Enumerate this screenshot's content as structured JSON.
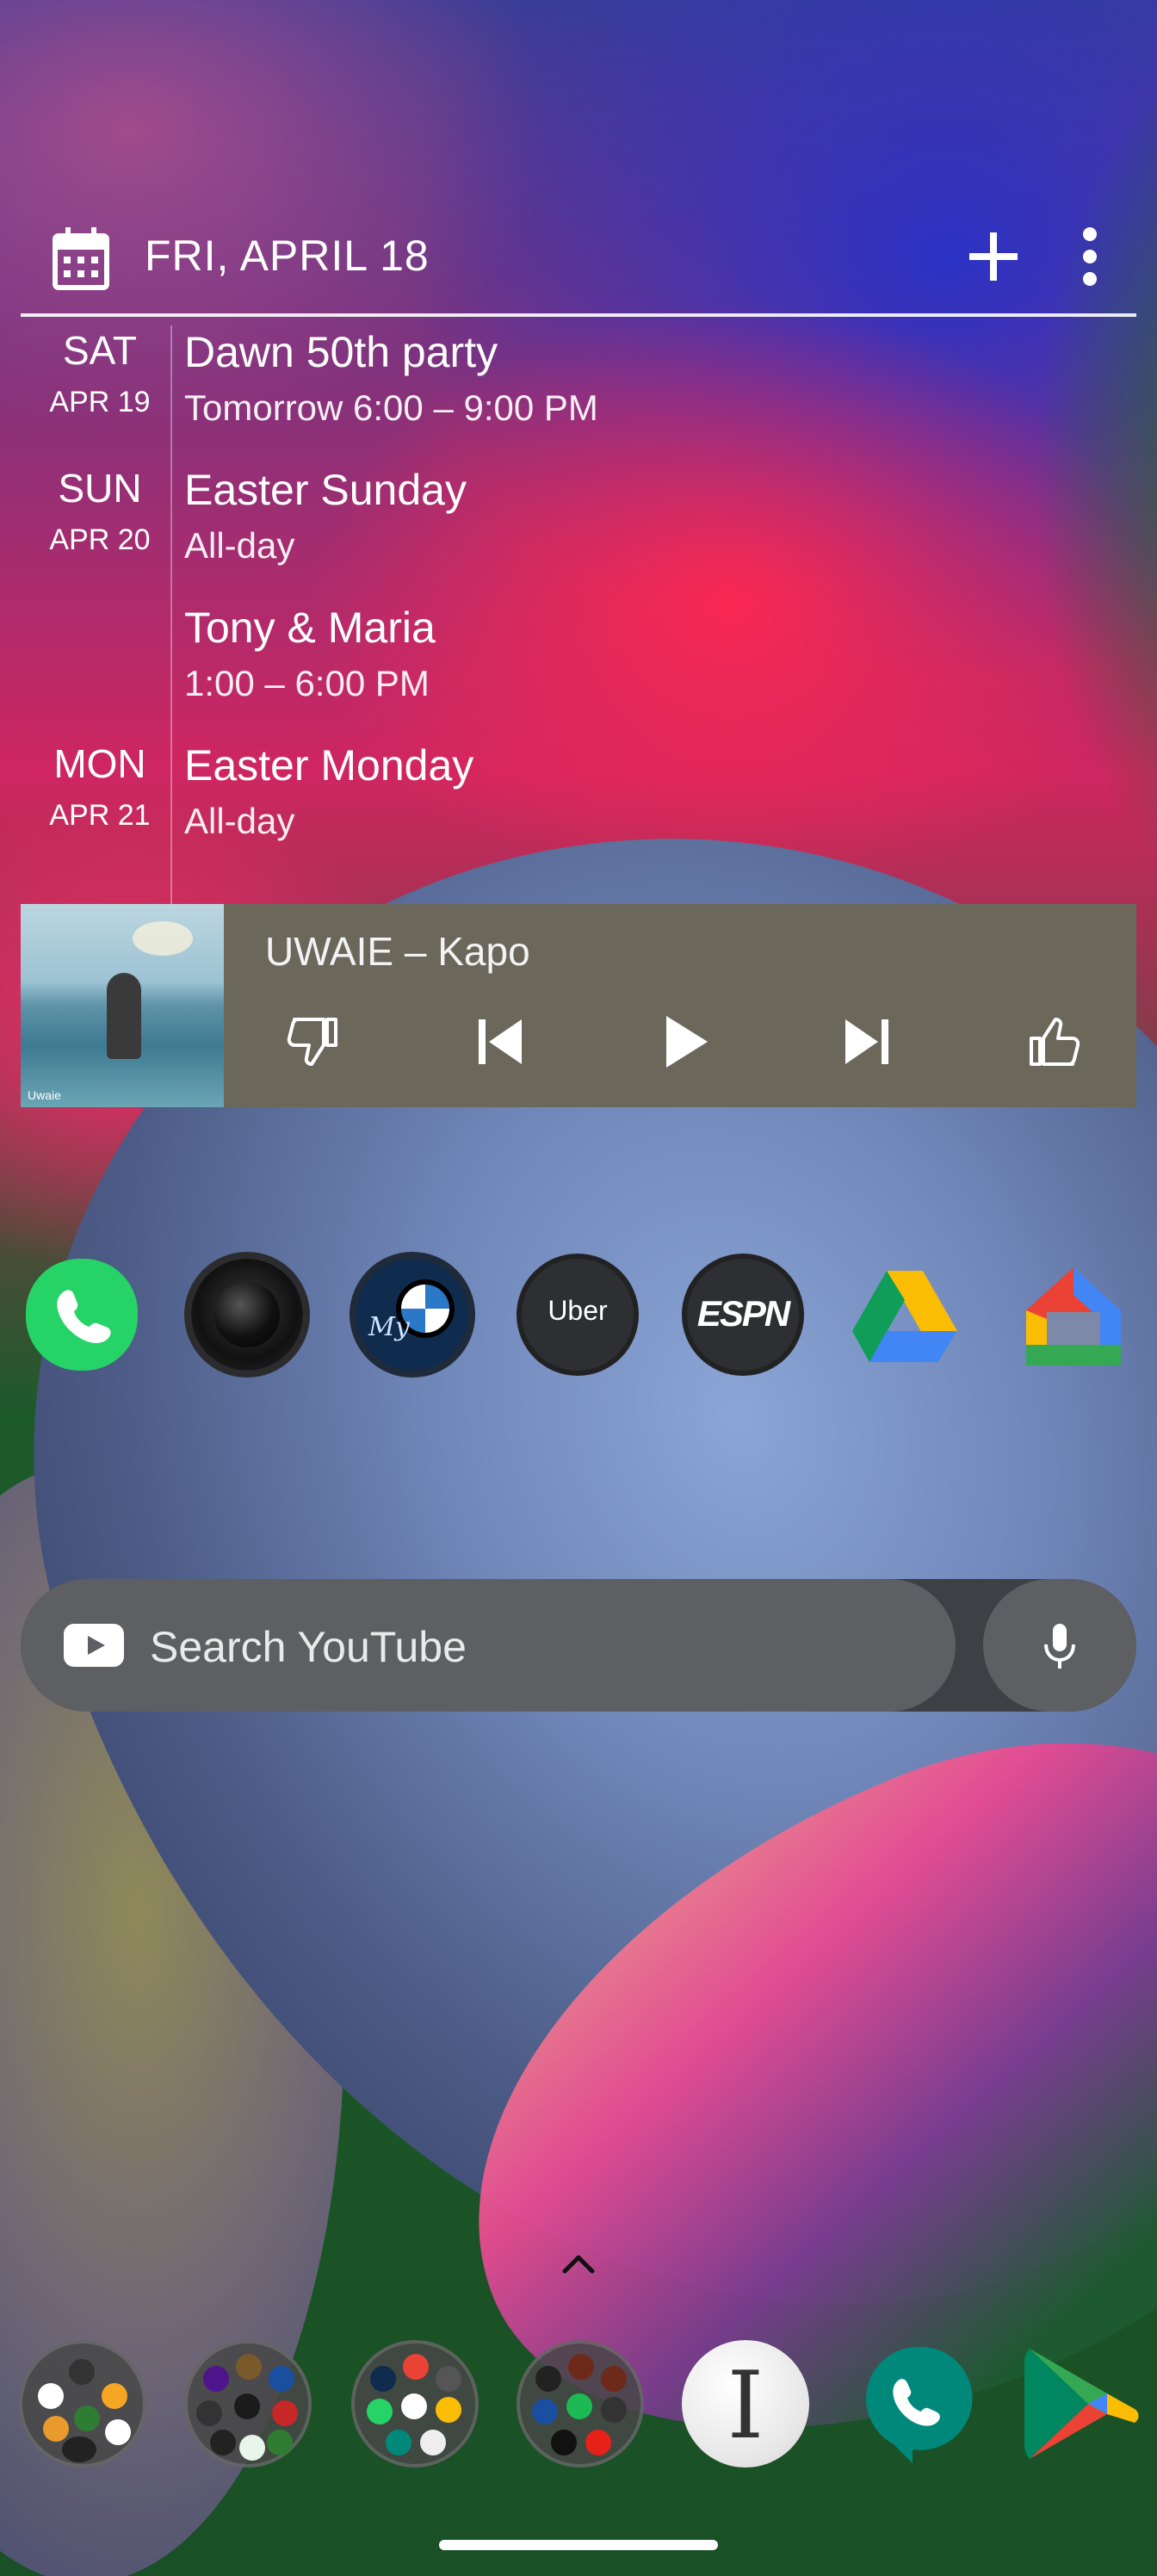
{
  "calendar": {
    "date_label": "FRI, APRIL 18",
    "events": [
      {
        "day": "SAT",
        "date": "APR 19",
        "title": "Dawn 50th party",
        "time": "Tomorrow 6:00 – 9:00 PM"
      },
      {
        "day": "SUN",
        "date": "APR 20",
        "title": "Easter Sunday",
        "time": "All-day"
      },
      {
        "day": "",
        "date": "",
        "title": "Tony & Maria",
        "time": "1:00 – 6:00 PM"
      },
      {
        "day": "MON",
        "date": "APR 21",
        "title": "Easter Monday",
        "time": "All-day"
      }
    ],
    "icons": {
      "calendar": "calendar-icon",
      "add": "plus-icon",
      "more": "more-vert-icon"
    }
  },
  "music": {
    "now_playing": "UWAIE – Kapo",
    "album_art_label": "Uwaie",
    "controls": [
      "thumbs-down-icon",
      "skip-previous-icon",
      "play-icon",
      "skip-next-icon",
      "thumbs-up-icon"
    ]
  },
  "apps": {
    "row": [
      {
        "name": "WhatsApp",
        "icon": "whatsapp-icon"
      },
      {
        "name": "Camera",
        "icon": "camera-icon"
      },
      {
        "name": "My BMW",
        "icon": "bmw-icon",
        "label": "My"
      },
      {
        "name": "Uber",
        "icon": "uber-icon",
        "label": "Uber"
      },
      {
        "name": "ESPN",
        "icon": "espn-icon",
        "label": "ESPN"
      },
      {
        "name": "Google Drive",
        "icon": "drive-icon"
      },
      {
        "name": "Google Home",
        "icon": "home-icon"
      }
    ]
  },
  "search": {
    "placeholder": "Search YouTube",
    "icon": "youtube-icon",
    "mic_icon": "mic-icon"
  },
  "dock": {
    "items": [
      {
        "name": "Folder 1",
        "icon": "folder-icon"
      },
      {
        "name": "Folder 2",
        "icon": "folder-icon"
      },
      {
        "name": "Folder 3",
        "icon": "folder-icon"
      },
      {
        "name": "Folder 4",
        "icon": "folder-icon"
      },
      {
        "name": "Instapaper",
        "icon": "instapaper-icon",
        "label": "I"
      },
      {
        "name": "Phone",
        "icon": "phone-icon"
      },
      {
        "name": "Play Store",
        "icon": "play-store-icon"
      }
    ]
  },
  "colors": {
    "music_bg": "#6b685b",
    "search_bg": "#5e5f63",
    "whatsapp": "#25d366",
    "phone": "#00897b"
  }
}
